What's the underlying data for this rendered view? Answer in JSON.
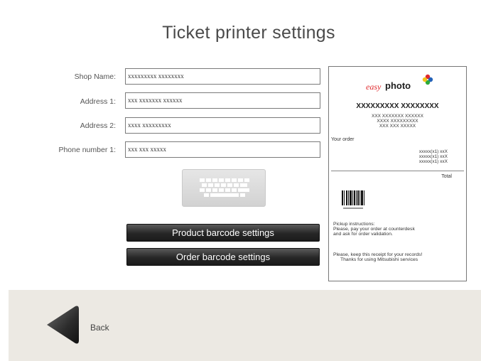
{
  "page": {
    "title": "Ticket printer settings"
  },
  "form": {
    "fields": [
      {
        "label": "Shop Name:",
        "value": "xxxxxxxxx xxxxxxxx"
      },
      {
        "label": "Address 1:",
        "value": "xxx xxxxxxx xxxxxx"
      },
      {
        "label": "Address 2:",
        "value": "xxxx  xxxxxxxxx"
      },
      {
        "label": "Phone number 1:",
        "value": "xxx xxx xxxxx"
      }
    ]
  },
  "buttons": {
    "keyboard_icon": "keyboard-icon",
    "product_barcode": "Product barcode settings",
    "order_barcode": "Order barcode settings"
  },
  "receipt": {
    "logo_easy": "easy",
    "logo_photo": "photo",
    "shop_name": "XXXXXXXXX XXXXXXXX",
    "address_1": "XXX XXXXXXX XXXXXX",
    "address_2": "XXXX  XXXXXXXXX",
    "phone": "XXX XXX XXXXX",
    "your_order": "Your order",
    "items": [
      "xxxxx(x1)   xxX",
      "xxxxx(x1)   xxX",
      "xxxxx(x1)   xxX"
    ],
    "total": "Total",
    "pickup_title": "Pickup instructions:",
    "pickup_line1": "Please, pay your order at counterdesk",
    "pickup_line2": "and ask for order validation.",
    "keep_line1": "Please, keep this receipt for your records!",
    "keep_line2": "Thanks for using Mitsubishi services"
  },
  "footer": {
    "back_label": "Back"
  },
  "colors": {
    "button_dark": "#262626",
    "footer_bg": "#ece9e3",
    "logo_red": "#e0282c",
    "logo_green": "#2eaa3a",
    "logo_blue": "#2462b8",
    "logo_yellow": "#f2c21a"
  }
}
